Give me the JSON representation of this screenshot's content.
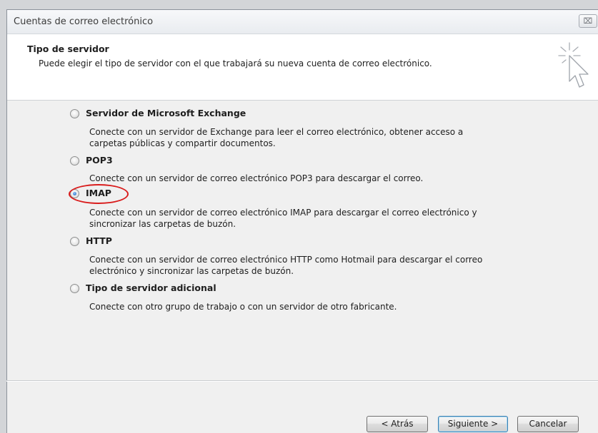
{
  "window": {
    "title": "Cuentas de correo electrónico",
    "close_symbol": "⌧"
  },
  "header": {
    "title": "Tipo de servidor",
    "subtitle": "Puede elegir el tipo de servidor con el que trabajará su nueva cuenta de correo electrónico.",
    "icon": "wizard-cursor-icon"
  },
  "options": [
    {
      "label": "Servidor de Microsoft Exchange",
      "selected": false,
      "description": "Conecte con un servidor de Exchange para leer el correo electrónico, obtener acceso a carpetas públicas y compartir documentos."
    },
    {
      "label": "POP3",
      "selected": false,
      "description": "Conecte con un servidor de correo electrónico POP3 para descargar el correo."
    },
    {
      "label": "IMAP",
      "selected": true,
      "description": "Conecte con un servidor de correo electrónico IMAP para descargar el correo electrónico y sincronizar las carpetas de buzón."
    },
    {
      "label": "HTTP",
      "selected": false,
      "description": "Conecte con un servidor de correo electrónico HTTP como Hotmail para descargar el correo electrónico y sincronizar las carpetas de buzón."
    },
    {
      "label": "Tipo de servidor adicional",
      "selected": false,
      "description": "Conecte con otro grupo de trabajo o con un servidor de otro fabricante."
    }
  ],
  "buttons": {
    "back": "< Atrás",
    "next": "Siguiente >",
    "cancel": "Cancelar"
  },
  "colors": {
    "highlight": "#d91c1c",
    "header_bg": "#ffffff",
    "body_bg": "#f0f0f0"
  }
}
